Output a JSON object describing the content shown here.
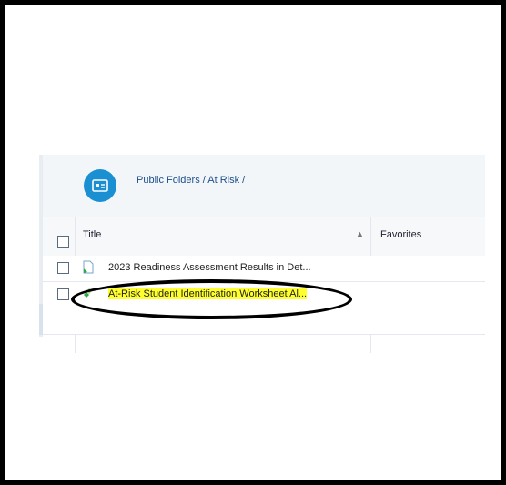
{
  "breadcrumb": "Public Folders / At Risk /",
  "columns": {
    "title": "Title",
    "favorites": "Favorites"
  },
  "rows": [
    {
      "title": "2023 Readiness Assessment Results in Det..."
    },
    {
      "title": "At-Risk Student Identification Worksheet Al..."
    }
  ],
  "colors": {
    "accent": "#1a8fd1",
    "highlight": "#ffff30",
    "link": "#1b4e8a"
  },
  "icons": {
    "folder": "folder-icon",
    "sort": "sort-icon",
    "document": "document-icon"
  }
}
